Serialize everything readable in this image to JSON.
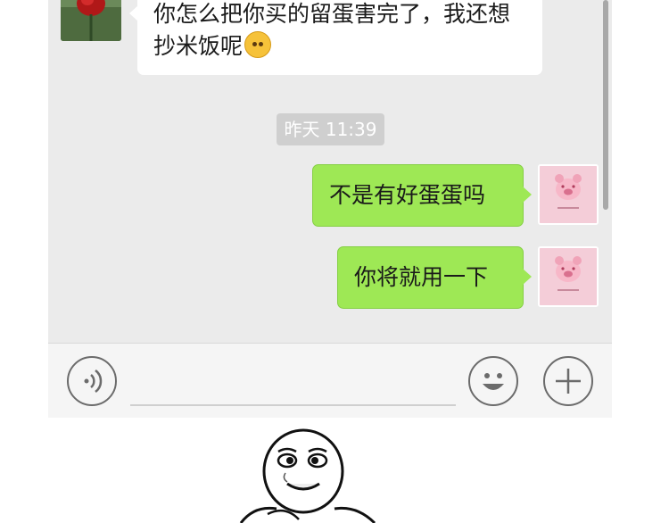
{
  "messages": [
    {
      "sender": "contact",
      "text": "你怎么把你买的留蛋害完了，我还想抄米饭呢",
      "emoji": "worried-face"
    },
    {
      "sender": "me",
      "text": "不是有好蛋蛋吗"
    },
    {
      "sender": "me",
      "text": "你将就用一下"
    }
  ],
  "timestamp": "昨天 11:39",
  "avatars": {
    "contact": "rose-photo",
    "me": "pink-pig-illustration"
  },
  "input_bar": {
    "voice_icon": "voice-icon",
    "emoji_icon": "emoji-icon",
    "plus_icon": "plus-icon",
    "placeholder": ""
  },
  "colors": {
    "chat_bg": "#ebebeb",
    "outgoing_bubble": "#9ee855",
    "incoming_bubble": "#ffffff",
    "timestamp_bg": "#cfcfcf"
  }
}
